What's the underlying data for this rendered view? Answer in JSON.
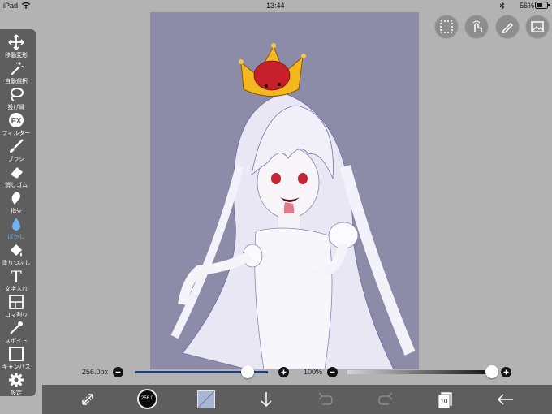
{
  "status": {
    "device": "iPad",
    "time": "13:44",
    "battery": "56%"
  },
  "toolbar": {
    "tools": [
      {
        "label": "移動変形"
      },
      {
        "label": "自動選択"
      },
      {
        "label": "投げ縄"
      },
      {
        "label": "フィルター",
        "icon_text": "FX"
      },
      {
        "label": "ブラシ"
      },
      {
        "label": "消しゴム"
      },
      {
        "label": "指先"
      },
      {
        "label": "ぼかし",
        "active": true
      },
      {
        "label": "塗りつぶし"
      },
      {
        "label": "文字入れ",
        "icon_text": "T"
      },
      {
        "label": "コマ割り"
      },
      {
        "label": "スポイト"
      },
      {
        "label": "キャンバス"
      },
      {
        "label": "設定"
      }
    ]
  },
  "brush": {
    "size_label": "256.0px",
    "size_fraction": 0.85,
    "opacity_label": "100%",
    "opacity_fraction": 1.0
  },
  "bottombar": {
    "brush_preview_value": "256.0",
    "layer_count": "10"
  },
  "colors": {
    "accent": "#6fb4f2",
    "toolbar_bg": "#5e5e5e",
    "canvas_bg": "#8c8ca8",
    "slider_fill": "#1f3f7a"
  }
}
